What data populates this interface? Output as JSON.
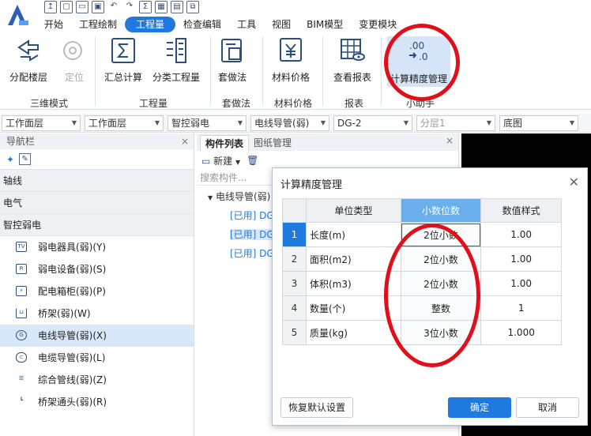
{
  "menu": {
    "tabs": [
      "开始",
      "工程绘制",
      "工程量",
      "检查编辑",
      "工具",
      "视图",
      "BIM模型",
      "变更模块"
    ],
    "active_tab": "工程量"
  },
  "ribbon": {
    "buttons": {
      "dist_floor": "分配楼层",
      "locate": "定位",
      "summary_calc": "汇总计算",
      "class_qty": "分类工程量",
      "method": "套做法",
      "material_price": "材料价格",
      "view_report": "查看报表",
      "precision_mgmt": "计算精度管理"
    },
    "groups": {
      "3d_mode": "三维模式",
      "quantity": "工程量",
      "method": "套做法",
      "material_price": "材料价格",
      "report": "报表",
      "assistant": "小助手"
    }
  },
  "dropdowns": {
    "d1": "工作面层",
    "d2": "工作面层",
    "d3": "智控弱电",
    "d4": "电线导管(弱)",
    "d5": "DG-2",
    "d6": "分层1",
    "d7": "底图"
  },
  "nav": {
    "title": "导航栏",
    "groups": [
      "轴线",
      "电气",
      "智控弱电"
    ],
    "items": [
      {
        "icon": "TV",
        "label": "弱电器具(弱)(Y)"
      },
      {
        "icon": "R",
        "label": "弱电设备(弱)(S)"
      },
      {
        "icon": "box",
        "label": "配电箱柜(弱)(P)"
      },
      {
        "icon": "tray",
        "label": "桥架(弱)(W)"
      },
      {
        "icon": "conduit",
        "label": "电线导管(弱)(X)"
      },
      {
        "icon": "cable",
        "label": "电缆导管(弱)(L)"
      },
      {
        "icon": "pipe",
        "label": "综合管线(弱)(Z)"
      },
      {
        "icon": "joint",
        "label": "桥架通头(弱)(R)"
      }
    ]
  },
  "components": {
    "tabs": [
      "构件列表",
      "图纸管理"
    ],
    "new_btn": "新建",
    "search_placeholder": "搜索构件...",
    "root": "电线导管(弱)",
    "leaves": [
      "[已用] DG",
      "[已用] DG",
      "[已用] DG"
    ]
  },
  "dialog": {
    "title": "计算精度管理",
    "headers": [
      "单位类型",
      "小数位数",
      "数值样式"
    ],
    "rows": [
      {
        "idx": "1",
        "unit": "长度(m)",
        "dec": "2位小数",
        "fmt": "1.00"
      },
      {
        "idx": "2",
        "unit": "面积(m2)",
        "dec": "2位小数",
        "fmt": "1.00"
      },
      {
        "idx": "3",
        "unit": "体积(m3)",
        "dec": "2位小数",
        "fmt": "1.00"
      },
      {
        "idx": "4",
        "unit": "数量(个)",
        "dec": "整数",
        "fmt": "1"
      },
      {
        "idx": "5",
        "unit": "质量(kg)",
        "dec": "3位小数",
        "fmt": "1.000"
      }
    ],
    "restore_btn": "恢复默认设置",
    "ok_btn": "确定",
    "cancel_btn": "取消"
  },
  "colors": {
    "accent": "#1f7ae0",
    "annotation": "#e0101a"
  }
}
